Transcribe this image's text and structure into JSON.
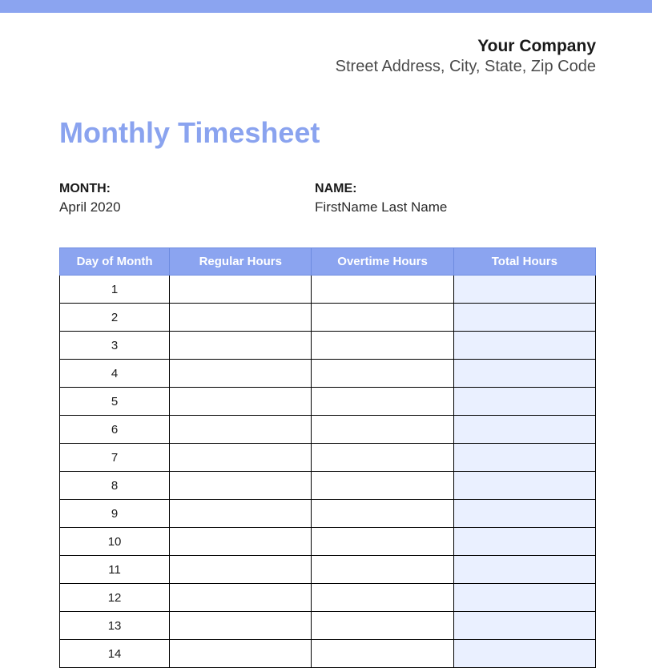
{
  "header": {
    "company_name": "Your Company",
    "company_address": "Street Address, City, State, Zip Code"
  },
  "title": "Monthly Timesheet",
  "meta": {
    "month_label": "MONTH:",
    "month_value": "April 2020",
    "name_label": "NAME:",
    "name_value": "FirstName Last Name"
  },
  "table": {
    "headers": {
      "day": "Day of Month",
      "regular": "Regular Hours",
      "overtime": "Overtime Hours",
      "total": "Total Hours"
    },
    "rows": [
      {
        "day": "1",
        "regular": "",
        "overtime": "",
        "total": ""
      },
      {
        "day": "2",
        "regular": "",
        "overtime": "",
        "total": ""
      },
      {
        "day": "3",
        "regular": "",
        "overtime": "",
        "total": ""
      },
      {
        "day": "4",
        "regular": "",
        "overtime": "",
        "total": ""
      },
      {
        "day": "5",
        "regular": "",
        "overtime": "",
        "total": ""
      },
      {
        "day": "6",
        "regular": "",
        "overtime": "",
        "total": ""
      },
      {
        "day": "7",
        "regular": "",
        "overtime": "",
        "total": ""
      },
      {
        "day": "8",
        "regular": "",
        "overtime": "",
        "total": ""
      },
      {
        "day": "9",
        "regular": "",
        "overtime": "",
        "total": ""
      },
      {
        "day": "10",
        "regular": "",
        "overtime": "",
        "total": ""
      },
      {
        "day": "11",
        "regular": "",
        "overtime": "",
        "total": ""
      },
      {
        "day": "12",
        "regular": "",
        "overtime": "",
        "total": ""
      },
      {
        "day": "13",
        "regular": "",
        "overtime": "",
        "total": ""
      },
      {
        "day": "14",
        "regular": "",
        "overtime": "",
        "total": ""
      }
    ]
  }
}
